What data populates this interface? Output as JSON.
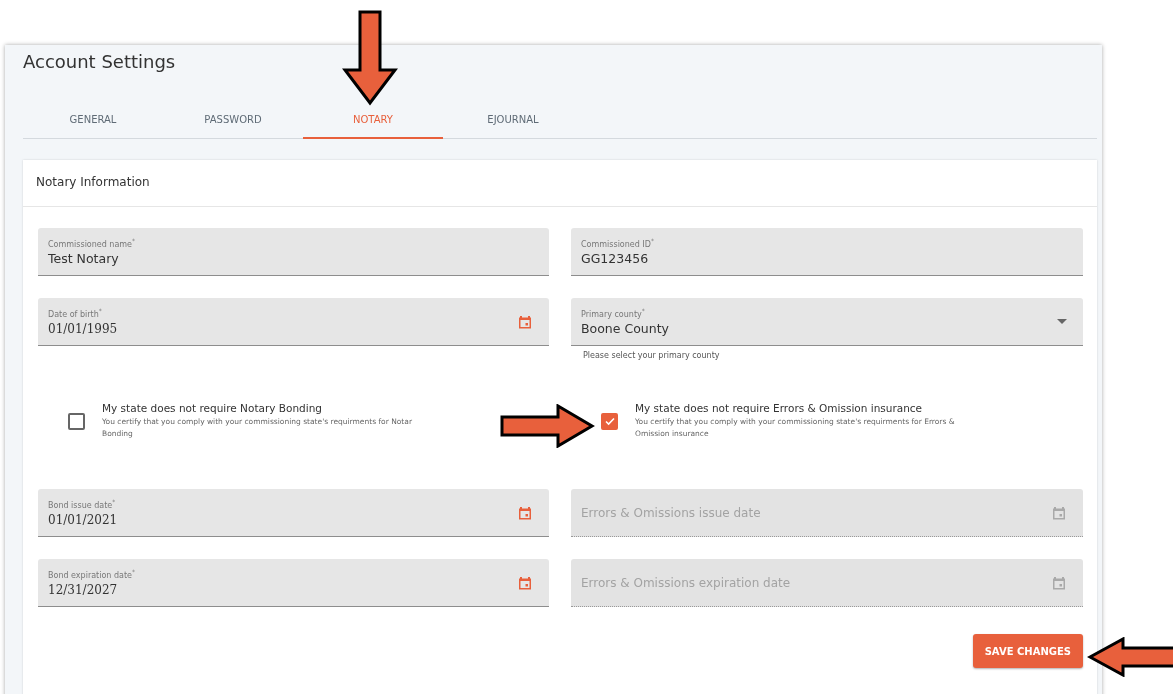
{
  "page": {
    "title": "Account Settings"
  },
  "tabs": [
    {
      "label": "GENERAL",
      "selected": false
    },
    {
      "label": "PASSWORD",
      "selected": false
    },
    {
      "label": "NOTARY",
      "selected": true
    },
    {
      "label": "EJOURNAL",
      "selected": false
    }
  ],
  "section": {
    "title": "Notary Information"
  },
  "fields_top": [
    {
      "kind": "text",
      "label": "Commissioned name$^{*}$",
      "value": "Test Notary",
      "disabled": false
    },
    {
      "kind": "text",
      "label": "Commissioned ID$^{*}$",
      "value": "GG123456",
      "disabled": false
    },
    {
      "kind": "date",
      "label": "Date of birth$^{*}$",
      "value": "01/01/1995",
      "disabled": false
    },
    {
      "kind": "select",
      "label": "Primary county$^{*}$",
      "value": "Boone County",
      "helper": "Please select your primary county",
      "disabled": false
    }
  ],
  "checkboxes": [
    {
      "label": "My state does not require Notary Bonding",
      "hint_lines": [
        "You certify that you comply with your commissioning state's requirments for Notar",
        "Bonding"
      ],
      "checked": false
    },
    {
      "label": "My state does not require Errors & Omission insurance",
      "hint_lines": [
        "You certify that you comply with your commissioning state's requirments for Errors &",
        "Omission insurance"
      ],
      "checked": true
    }
  ],
  "fields_bottom": [
    {
      "kind": "date",
      "label": "Bond issue date$^{*}$",
      "value": "01/01/2021",
      "disabled": false
    },
    {
      "kind": "date",
      "placeholder": "Errors & Omissions issue date",
      "disabled": true
    },
    {
      "kind": "date",
      "label": "Bond expiration date$^{*}$",
      "value": "12/31/2027",
      "disabled": false
    },
    {
      "kind": "date",
      "placeholder": "Errors & Omissions expiration date",
      "disabled": true
    }
  ],
  "save_button": "SAVE CHANGES"
}
